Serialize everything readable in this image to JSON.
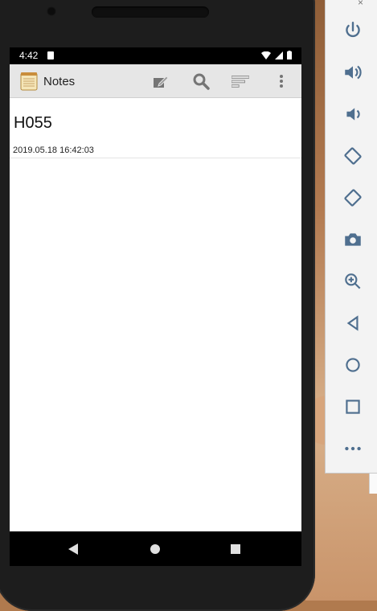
{
  "status_bar": {
    "time": "4:42"
  },
  "app_bar": {
    "title": "Notes",
    "actions": [
      {
        "icon": "compose-icon"
      },
      {
        "icon": "search-icon"
      },
      {
        "icon": "sort-icon"
      },
      {
        "icon": "overflow-menu-icon"
      }
    ]
  },
  "notes": [
    {
      "title": "H055",
      "date": "2019.05.18 16:42:03"
    }
  ],
  "navigation": [
    "back",
    "home",
    "recents"
  ],
  "emulator_toolbar": {
    "close_glyph": "×",
    "buttons": [
      "power",
      "volume-up",
      "volume-down",
      "rotate-left",
      "rotate-right",
      "screenshot",
      "zoom",
      "back",
      "home",
      "overview",
      "more"
    ]
  },
  "colors": {
    "appbar": "#e6e6e6",
    "icon_gray": "#757575",
    "emulator_icon": "#4f6f8f"
  }
}
